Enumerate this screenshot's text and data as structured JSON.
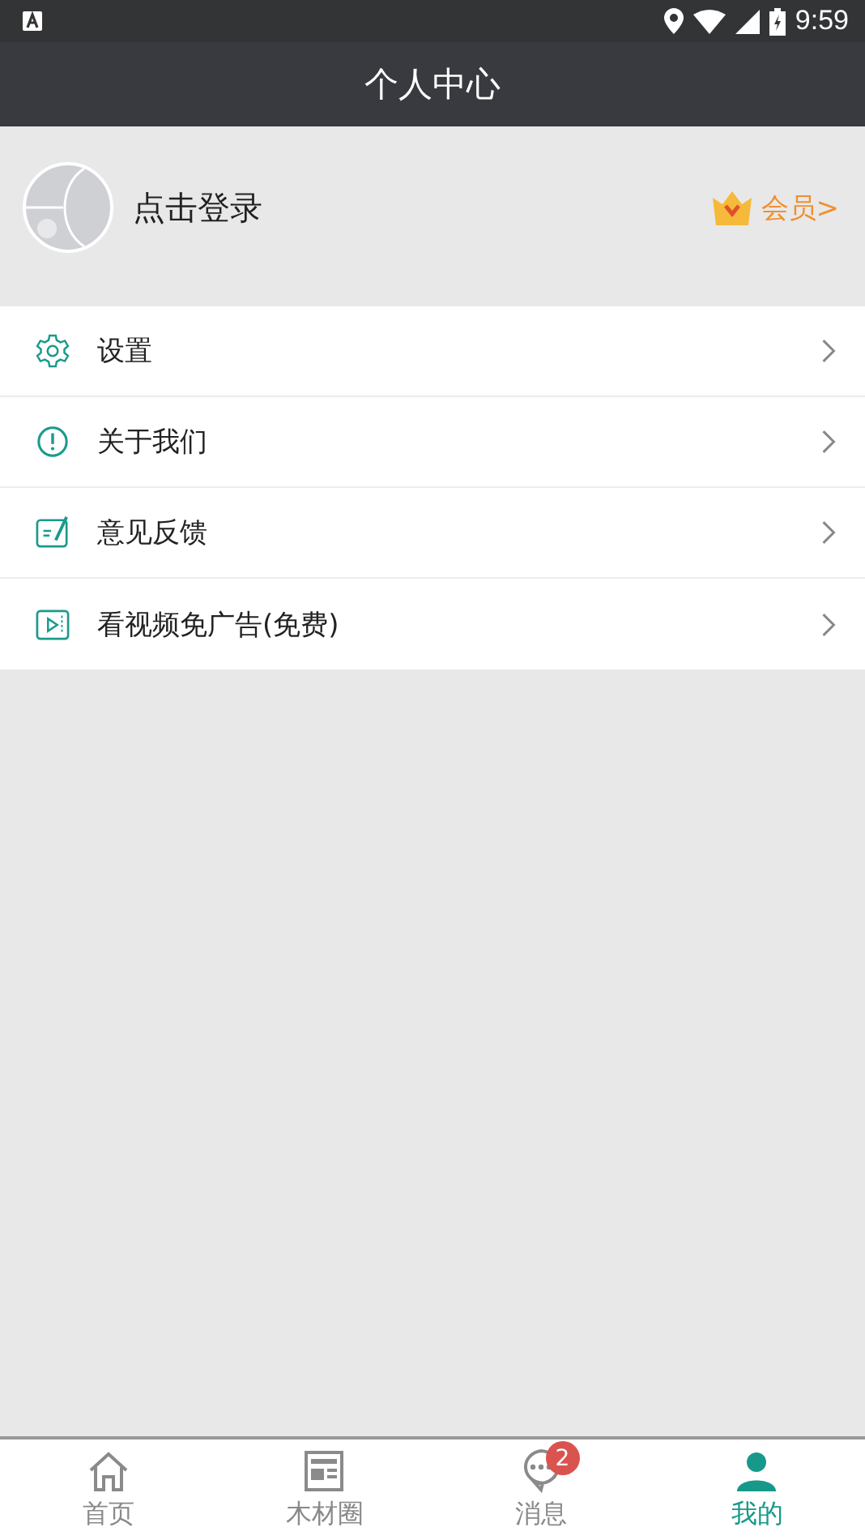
{
  "status_bar": {
    "time": "9:59"
  },
  "header": {
    "title": "个人中心"
  },
  "profile": {
    "login_text": "点击登录",
    "vip_text": "会员>"
  },
  "menu": [
    {
      "label": "设置",
      "kind": "settings"
    },
    {
      "label": "关于我们",
      "kind": "about"
    },
    {
      "label": "意见反馈",
      "kind": "feedback"
    },
    {
      "label": "看视频免广告(免费)",
      "kind": "video"
    }
  ],
  "tabs": [
    {
      "label": "首页",
      "kind": "home",
      "selected": false
    },
    {
      "label": "木材圈",
      "kind": "feed",
      "selected": false
    },
    {
      "label": "消息",
      "kind": "chat",
      "selected": false,
      "badge": "2"
    },
    {
      "label": "我的",
      "kind": "me",
      "selected": true
    }
  ]
}
